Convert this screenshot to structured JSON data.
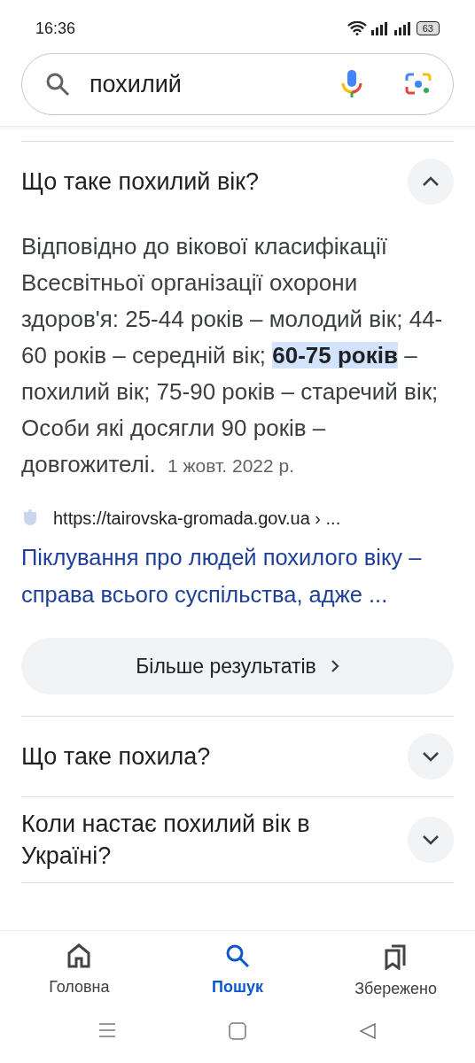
{
  "status_bar": {
    "time": "16:36",
    "battery": "63"
  },
  "search": {
    "value": "похилий"
  },
  "questions": [
    {
      "title": "Що таке похилий вік?",
      "expanded": true,
      "answer": "Відповідно до вікової класифікації Всесвітньої організації охорони здоров'я: 25-44 років – молодий вік; 44-60 років – середній вік; **60-75 років** – похилий вік; 75-90 років – старечий вік; Особи які досягли 90 років – довгожителі.",
      "date": "1 жовт. 2022 р.",
      "source_url": "https://tairovska-gromada.gov.ua › ...",
      "source_title": "Піклування про людей похилого віку – справа всього суспільства, адже ..."
    },
    {
      "title": "Що таке похила?",
      "expanded": false
    },
    {
      "title": "Коли настає похилий вік в Україні?",
      "expanded": false
    }
  ],
  "more_button": "Більше результатів",
  "nav": [
    {
      "label": "Головна",
      "selected": false
    },
    {
      "label": "Пошук",
      "selected": true
    },
    {
      "label": "Збережено",
      "selected": false
    }
  ]
}
